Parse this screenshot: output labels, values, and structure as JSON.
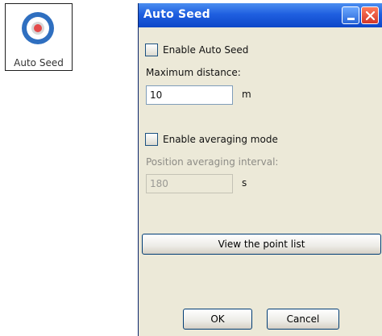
{
  "icon": {
    "name": "auto-seed-icon",
    "label": "Auto Seed"
  },
  "dialog": {
    "title": "Auto Seed",
    "enable_auto_seed": {
      "label": "Enable Auto Seed",
      "checked": false
    },
    "max_distance": {
      "label": "Maximum distance:",
      "value": "10",
      "unit": "m"
    },
    "enable_averaging": {
      "label": "Enable averaging mode",
      "checked": false
    },
    "avg_interval": {
      "label": "Position averaging interval:",
      "value": "180",
      "unit": "s",
      "disabled": true
    },
    "buttons": {
      "view_points": "View the point list",
      "ok": "OK",
      "cancel": "Cancel"
    }
  },
  "colors": {
    "title_bar": "#1f5fe0",
    "window_bg": "#ece9d8",
    "close_button": "#d2382a"
  }
}
